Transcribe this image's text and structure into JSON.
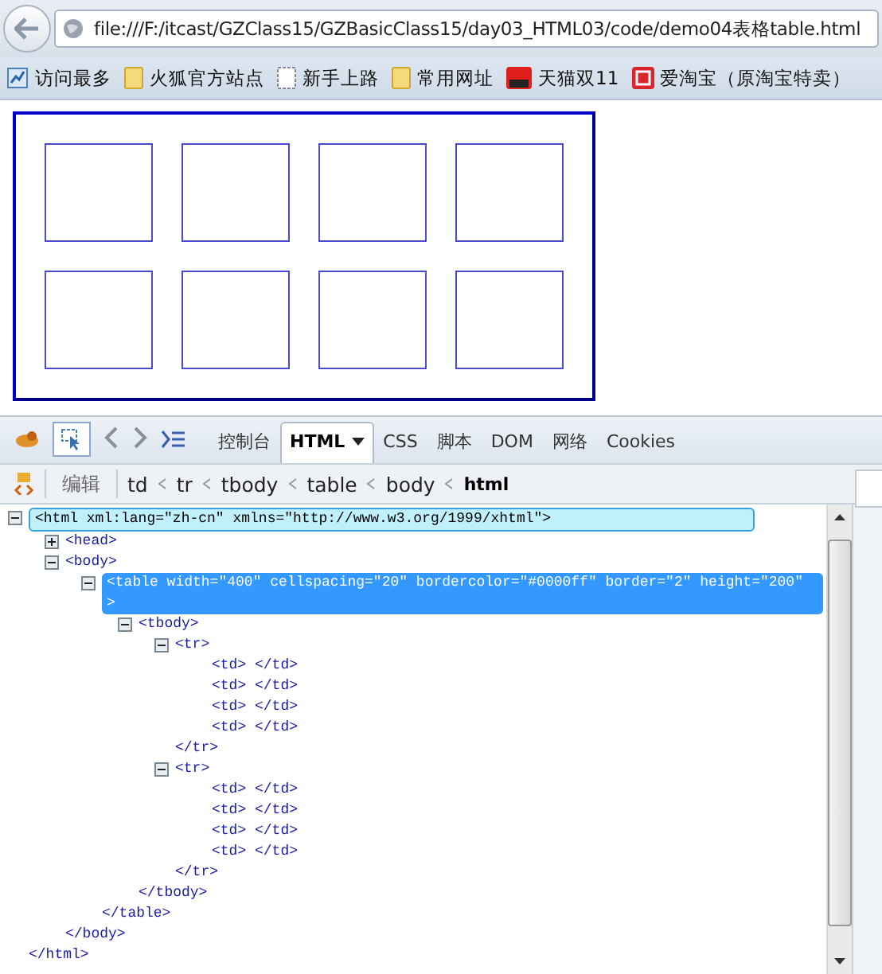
{
  "address_bar": {
    "url": "file:///F:/itcast/GZClass15/GZBasicClass15/day03_HTML03/code/demo04表格table.html"
  },
  "bookmarks": [
    {
      "kind": "chart",
      "label": "访问最多"
    },
    {
      "kind": "folder",
      "label": "火狐官方站点"
    },
    {
      "kind": "page",
      "label": "新手上路"
    },
    {
      "kind": "folder",
      "label": "常用网址"
    },
    {
      "kind": "tmall",
      "label": "天猫双11"
    },
    {
      "kind": "taobao",
      "label": "爱淘宝（原淘宝特卖）"
    }
  ],
  "devtools": {
    "tabs": [
      {
        "label": "控制台",
        "selected": false,
        "menu": false
      },
      {
        "label": "HTML",
        "selected": true,
        "menu": true
      },
      {
        "label": "CSS",
        "selected": false,
        "menu": false
      },
      {
        "label": "脚本",
        "selected": false,
        "menu": false
      },
      {
        "label": "DOM",
        "selected": false,
        "menu": false
      },
      {
        "label": "网络",
        "selected": false,
        "menu": false
      },
      {
        "label": "Cookies",
        "selected": false,
        "menu": false
      }
    ],
    "edit_button": "编辑",
    "breadcrumbs": [
      {
        "label": "td",
        "selected": false
      },
      {
        "label": "tr",
        "selected": false
      },
      {
        "label": "tbody",
        "selected": false
      },
      {
        "label": "table",
        "selected": false
      },
      {
        "label": "body",
        "selected": false
      },
      {
        "label": "html",
        "selected": true
      }
    ],
    "tree": [
      {
        "tag": "<html xml:lang=\"zh-cn\" xmlns=\"http://www.w3.org/1999/xhtml\">",
        "close": "</html>",
        "expanded": true,
        "selected": false,
        "hovered": true,
        "children": [
          {
            "tag": "<head>",
            "expanded": false,
            "selected": false,
            "hovered": false
          },
          {
            "tag": "<body>",
            "close": "</body>",
            "expanded": true,
            "selected": false,
            "hovered": false,
            "children": [
              {
                "tag": "<table width=\"400\" cellspacing=\"20\" bordercolor=\"#0000ff\" border=\"2\" height=\"200\" >",
                "close": "</table>",
                "expanded": true,
                "selected": true,
                "hovered": false,
                "children": [
                  {
                    "tag": "<tbody>",
                    "close": "</tbody>",
                    "expanded": true,
                    "selected": false,
                    "hovered": false,
                    "children": [
                      {
                        "tag": "<tr>",
                        "close": "</tr>",
                        "expanded": true,
                        "selected": false,
                        "hovered": false,
                        "children": [
                          {
                            "tag": "<td> </td>",
                            "selected": false,
                            "hovered": false
                          },
                          {
                            "tag": "<td> </td>",
                            "selected": false,
                            "hovered": false
                          },
                          {
                            "tag": "<td> </td>",
                            "selected": false,
                            "hovered": false
                          },
                          {
                            "tag": "<td> </td>",
                            "selected": false,
                            "hovered": false
                          }
                        ]
                      },
                      {
                        "tag": "<tr>",
                        "close": "</tr>",
                        "expanded": true,
                        "selected": false,
                        "hovered": false,
                        "children": [
                          {
                            "tag": "<td> </td>",
                            "selected": false,
                            "hovered": false
                          },
                          {
                            "tag": "<td> </td>",
                            "selected": false,
                            "hovered": false
                          },
                          {
                            "tag": "<td> </td>",
                            "selected": false,
                            "hovered": false
                          },
                          {
                            "tag": "<td> </td>",
                            "selected": false,
                            "hovered": false
                          }
                        ]
                      }
                    ]
                  }
                ]
              }
            ]
          }
        ]
      }
    ]
  }
}
